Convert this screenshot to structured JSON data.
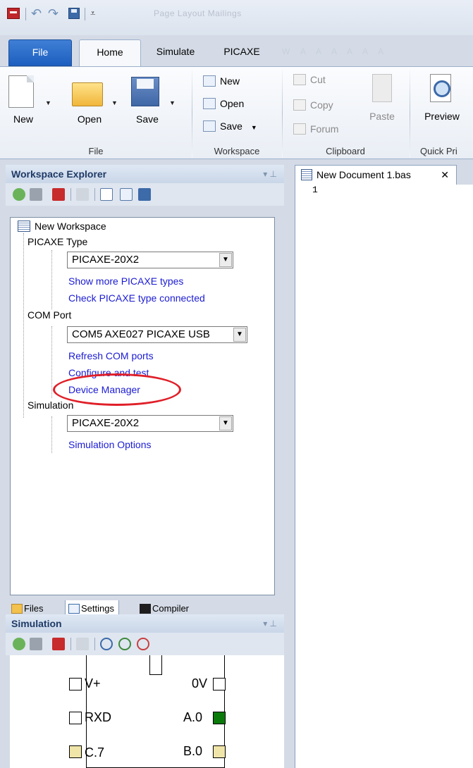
{
  "window": {
    "title_faded": "Page Layout      Mailings",
    "faded_tabs": "W  A  A  A  A  A  A"
  },
  "tabs": {
    "file": "File",
    "home": "Home",
    "simulate": "Simulate",
    "picaxe": "PICAXE"
  },
  "ribbon": {
    "file_group": {
      "label": "File",
      "new": "New",
      "open": "Open",
      "save": "Save"
    },
    "workspace_group": {
      "label": "Workspace",
      "new": "New",
      "open": "Open",
      "save": "Save"
    },
    "clipboard_group": {
      "label": "Clipboard",
      "cut": "Cut",
      "copy": "Copy",
      "forum": "Forum",
      "paste": "Paste"
    },
    "quick_print_group": {
      "label": "Quick Pri",
      "preview": "Preview"
    }
  },
  "workspace_explorer": {
    "title": "Workspace Explorer",
    "pin": "▾  ⊥",
    "tree": {
      "root": "New Workspace",
      "picaxe_type_label": "PICAXE Type",
      "picaxe_type_value": "PICAXE-20X2",
      "show_more_link": "Show more PICAXE types",
      "check_type_link": "Check PICAXE type connected",
      "com_port_label": "COM Port",
      "com_port_value": "COM5 AXE027 PICAXE USB",
      "refresh_link": "Refresh COM ports",
      "configure_link": "Configure and test",
      "device_manager_link": "Device Manager",
      "simulation_label": "Simulation",
      "simulation_value": "PICAXE-20X2",
      "simulation_options_link": "Simulation Options"
    },
    "bottom_tabs": {
      "files": "Files",
      "settings": "Settings",
      "compiler": "Compiler"
    }
  },
  "simulation_panel": {
    "title": "Simulation",
    "pin": "▾  ⊥",
    "pins": {
      "left": [
        "V+",
        "RXD",
        "C.7"
      ],
      "right": [
        "0V",
        "A.0",
        "B.0"
      ]
    }
  },
  "editor": {
    "tab_label": "New Document 1.bas",
    "close": "✕",
    "line_numbers": [
      "1"
    ]
  },
  "colors": {
    "link": "#1b1bd3",
    "highlight": "#e01f28",
    "pin_active": "#0a7a0a",
    "pin_yellow": "#f0e5a8"
  }
}
